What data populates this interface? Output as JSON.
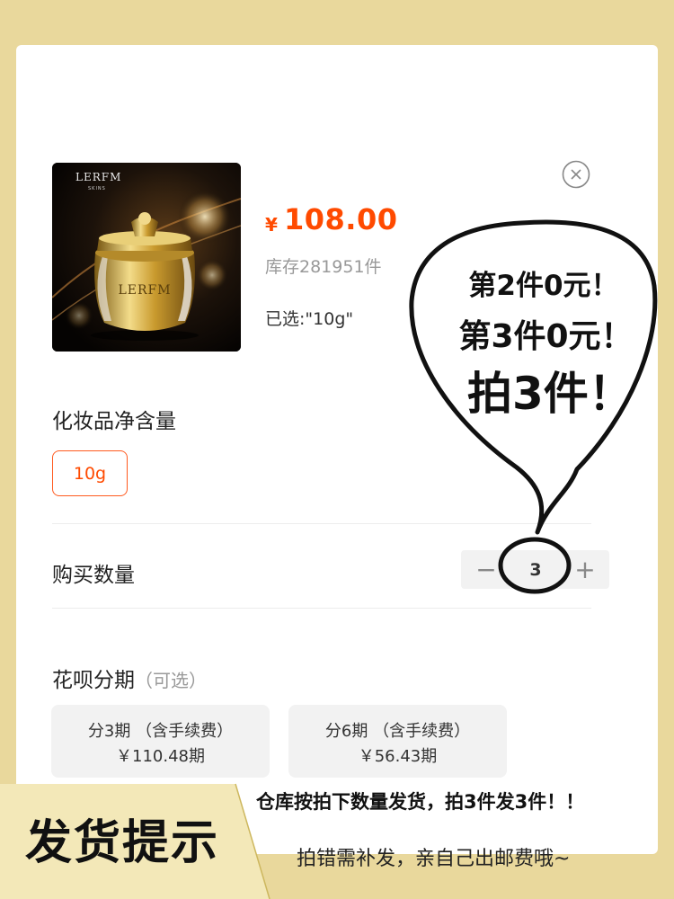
{
  "product": {
    "brand": "LERFM",
    "brand_sub": "SKINS",
    "currency": "¥",
    "price": "108.00",
    "stock": "库存281951件",
    "selected": "已选:\"10g\""
  },
  "spec": {
    "label": "化妆品净含量",
    "options": [
      "10g"
    ],
    "selected": "10g"
  },
  "quantity": {
    "label": "购买数量",
    "minus": "−",
    "value": "3",
    "plus": "+"
  },
  "installment": {
    "label": "花呗分期",
    "optional": "（可选）",
    "plans": [
      {
        "title": "分3期 （含手续费）",
        "price": "￥110.48期"
      },
      {
        "title": "分6期 （含手续费）",
        "price": "￥56.43期"
      }
    ]
  },
  "bubble": {
    "line1": "第2件0元！",
    "line2": "第3件0元！",
    "line3": "拍3件！"
  },
  "footer": {
    "notice": "仓库按拍下数量发货，拍3件发3件！！",
    "title": "发货提示",
    "subtitle": "拍错需补发，亲自己出邮费哦~"
  },
  "colors": {
    "accent": "#ff4a00",
    "background": "#e9d89c",
    "footer_panel": "#f3e8b8"
  },
  "icons": [
    "close-icon",
    "minus-icon",
    "plus-icon"
  ]
}
